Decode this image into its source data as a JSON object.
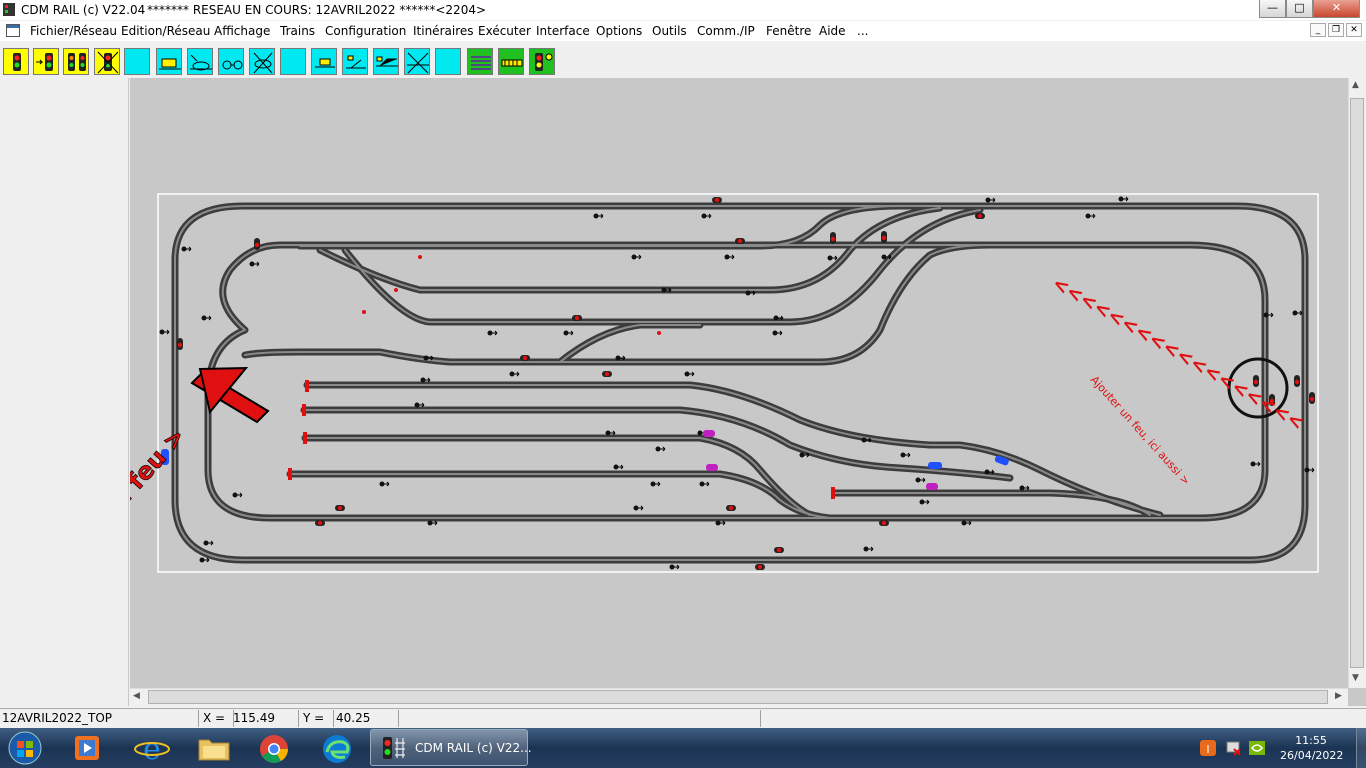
{
  "window": {
    "app_title": "CDM RAIL (c) V22.04",
    "doc_title": "******* RESEAU EN COURS: 12AVRIL2022 ******<2204>",
    "controls": {
      "minimize": "—",
      "maximize": "□",
      "close": "✕"
    }
  },
  "menu": {
    "items": [
      "Fichier/Réseau",
      "Edition/Réseau",
      "Affichage",
      "Trains",
      "Configuration",
      "Itinéraires",
      "Exécuter",
      "Interface",
      "Options",
      "Outils",
      "Comm./IP",
      "Fenêtre",
      "Aide",
      "..."
    ]
  },
  "toolbar": {
    "buttons": [
      "signal-icon",
      "signal-arrow-icon",
      "double-signal-icon",
      "signal-cross-icon",
      "blank-icon",
      "block-icon",
      "switch-block-icon",
      "double-block-icon",
      "cross-block-icon",
      "blank-icon",
      "platform-icon",
      "turnout-icon",
      "turnout-double-icon",
      "crossing-icon",
      "blank-icon",
      "rails-icon",
      "track-icon",
      "signal-settings-icon"
    ]
  },
  "canvas": {
    "annotations": {
      "left_label": "Ajouter un feu >",
      "right_label": "Ajouter un feu, ici aussi >",
      "chevrons": "<<<<<<<<<<<<<<<<<<"
    },
    "colors": {
      "rail": "#444444",
      "sleeper": "#777777",
      "signal_red": "#e01010",
      "buffer": "#e01010",
      "annotation": "#e01010",
      "loco_blue": "#2050ff",
      "loco_magenta": "#c020c0"
    }
  },
  "status": {
    "network_name": "12AVRIL2022_TOP",
    "x_label": "X =",
    "x_value": "115.49",
    "y_label": "Y =",
    "y_value": "40.25"
  },
  "taskbar": {
    "apps": [
      "start-orb",
      "media-player-icon",
      "ie-icon",
      "explorer-icon",
      "chrome-icon",
      "edge-icon"
    ],
    "active_app_label": "CDM RAIL (c) V22...",
    "time": "11:55",
    "date": "26/04/2022"
  }
}
